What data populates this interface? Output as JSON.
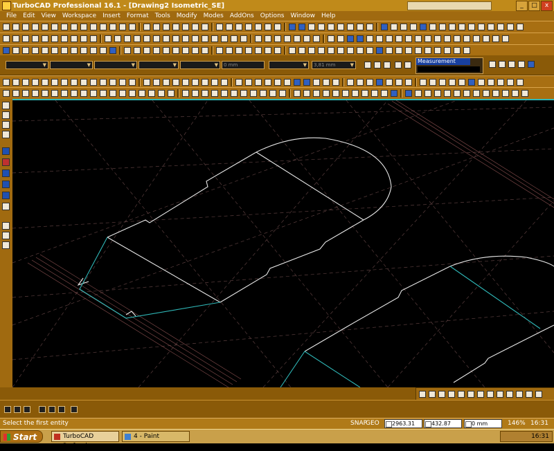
{
  "window": {
    "title": "TurboCAD Professional 16.1 - [Drawing2 Isometric_SE]",
    "minimize_label": "_",
    "maximize_label": "□",
    "close_label": "x"
  },
  "menu": {
    "items": [
      "File",
      "Edit",
      "View",
      "Workspace",
      "Insert",
      "Format",
      "Tools",
      "Modify",
      "Modes",
      "AddOns",
      "Options",
      "Window",
      "Help"
    ]
  },
  "property_bar": {
    "field1": "",
    "field2": "",
    "field3": "",
    "field4": "",
    "field5": "",
    "field6": "0 mm",
    "field7": "",
    "field8": "3,81 mm",
    "measurement_label": "Measurement"
  },
  "status": {
    "message": "Select the first entity",
    "snap_label": "SNAP",
    "geo_label": "GEO",
    "coord_x": "2963.31 mm",
    "coord_y": "432.87 mm",
    "coord_z": "0 mm",
    "zoom": "146%",
    "time": "16:31"
  },
  "taskbar": {
    "start_label": "Start",
    "tasks": [
      "TurboCAD Professio...",
      "4 - Paint"
    ],
    "clock": "16:31"
  },
  "colors": {
    "chrome": "#a86f12",
    "title_bar": "#c08a1a",
    "drawing_line": "#e8e8e8",
    "selection_line": "#2fb8b8",
    "construction_line": "#8a5a5a"
  },
  "icons": {
    "app": "turbocad-icon",
    "start": "windows-flag-icon"
  }
}
